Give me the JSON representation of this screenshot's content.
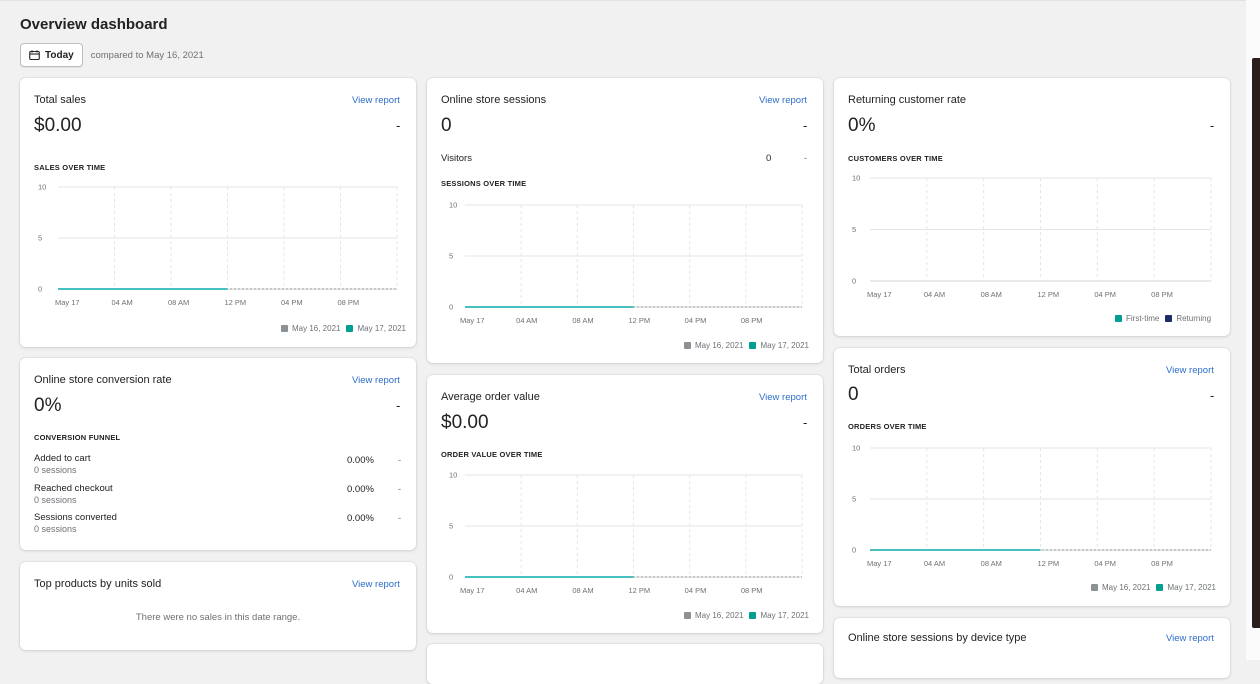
{
  "page": {
    "title": "Overview dashboard",
    "date_button": "Today",
    "compared_to": "compared to May 16, 2021"
  },
  "colors": {
    "accent_teal": "#47c1bf",
    "teal_swatch": "#009e93",
    "gray_swatch": "#8c9196",
    "navy_swatch": "#1f2a6b",
    "link": "#2c6ecb"
  },
  "x_labels": [
    "May 17",
    "04 AM",
    "08 AM",
    "12 PM",
    "04 PM",
    "08 PM"
  ],
  "cards": {
    "total_sales": {
      "title": "Total sales",
      "view": "View report",
      "value": "$0.00",
      "trend": "-",
      "section": "SALES OVER TIME",
      "legend": [
        "May 16, 2021",
        "May 17, 2021"
      ]
    },
    "sessions": {
      "title": "Online store sessions",
      "view": "View report",
      "value": "0",
      "trend": "-",
      "visitors_label": "Visitors",
      "visitors_value": "0",
      "visitors_trend": "-",
      "section": "SESSIONS OVER TIME",
      "legend": [
        "May 16, 2021",
        "May 17, 2021"
      ]
    },
    "returning": {
      "title": "Returning customer rate",
      "value": "0%",
      "trend": "-",
      "section": "CUSTOMERS OVER TIME",
      "legend": [
        "First-time",
        "Returning"
      ]
    },
    "conversion": {
      "title": "Online store conversion rate",
      "view": "View report",
      "value": "0%",
      "trend": "-",
      "section": "CONVERSION FUNNEL",
      "rows": [
        {
          "label": "Added to cart",
          "sub": "0 sessions",
          "value": "0.00%",
          "trend": "-"
        },
        {
          "label": "Reached checkout",
          "sub": "0 sessions",
          "value": "0.00%",
          "trend": "-"
        },
        {
          "label": "Sessions converted",
          "sub": "0 sessions",
          "value": "0.00%",
          "trend": "-"
        }
      ]
    },
    "aov": {
      "title": "Average order value",
      "view": "View report",
      "value": "$0.00",
      "trend": "-",
      "section": "ORDER VALUE OVER TIME",
      "legend": [
        "May 16, 2021",
        "May 17, 2021"
      ]
    },
    "orders": {
      "title": "Total orders",
      "view": "View report",
      "value": "0",
      "trend": "-",
      "section": "ORDERS OVER TIME",
      "legend": [
        "May 16, 2021",
        "May 17, 2021"
      ]
    },
    "top_products": {
      "title": "Top products by units sold",
      "view": "View report",
      "empty": "There were no sales in this date range."
    },
    "device": {
      "title": "Online store sessions by device type",
      "view": "View report"
    }
  },
  "chart_data": [
    {
      "type": "line",
      "title": "SALES OVER TIME",
      "categories": [
        "May 17",
        "04 AM",
        "08 AM",
        "12 PM",
        "04 PM",
        "08 PM"
      ],
      "ylim": [
        0,
        10
      ],
      "yticks": [
        0,
        5,
        10
      ],
      "grid": true,
      "legend": "bottom-right",
      "series": [
        {
          "name": "May 16, 2021",
          "values": [
            0,
            0,
            0,
            0,
            0,
            0
          ],
          "style": "dashed"
        },
        {
          "name": "May 17, 2021",
          "values": [
            0,
            0,
            0,
            0
          ],
          "style": "solid"
        }
      ]
    },
    {
      "type": "line",
      "title": "SESSIONS OVER TIME",
      "categories": [
        "May 17",
        "04 AM",
        "08 AM",
        "12 PM",
        "04 PM",
        "08 PM"
      ],
      "ylim": [
        0,
        10
      ],
      "yticks": [
        0,
        5,
        10
      ],
      "grid": true,
      "legend": "bottom-right",
      "series": [
        {
          "name": "May 16, 2021",
          "values": [
            0,
            0,
            0,
            0,
            0,
            0
          ],
          "style": "dashed"
        },
        {
          "name": "May 17, 2021",
          "values": [
            0,
            0,
            0,
            0
          ],
          "style": "solid"
        }
      ]
    },
    {
      "type": "line",
      "title": "CUSTOMERS OVER TIME",
      "categories": [
        "May 17",
        "04 AM",
        "08 AM",
        "12 PM",
        "04 PM",
        "08 PM"
      ],
      "ylim": [
        0,
        10
      ],
      "yticks": [
        0,
        5,
        10
      ],
      "grid": true,
      "legend": "bottom-right",
      "series": [
        {
          "name": "First-time",
          "values": []
        },
        {
          "name": "Returning",
          "values": []
        }
      ]
    },
    {
      "type": "line",
      "title": "ORDER VALUE OVER TIME",
      "categories": [
        "May 17",
        "04 AM",
        "08 AM",
        "12 PM",
        "04 PM",
        "08 PM"
      ],
      "ylim": [
        0,
        10
      ],
      "yticks": [
        0,
        5,
        10
      ],
      "grid": true,
      "legend": "bottom-right",
      "series": [
        {
          "name": "May 16, 2021",
          "values": [
            0,
            0,
            0,
            0,
            0,
            0
          ],
          "style": "dashed"
        },
        {
          "name": "May 17, 2021",
          "values": [
            0,
            0,
            0,
            0
          ],
          "style": "solid"
        }
      ]
    },
    {
      "type": "line",
      "title": "ORDERS OVER TIME",
      "categories": [
        "May 17",
        "04 AM",
        "08 AM",
        "12 PM",
        "04 PM",
        "08 PM"
      ],
      "ylim": [
        0,
        10
      ],
      "yticks": [
        0,
        5,
        10
      ],
      "grid": true,
      "legend": "bottom-right",
      "series": [
        {
          "name": "May 16, 2021",
          "values": [
            0,
            0,
            0,
            0,
            0,
            0
          ],
          "style": "dashed"
        },
        {
          "name": "May 17, 2021",
          "values": [
            0,
            0,
            0,
            0
          ],
          "style": "solid"
        }
      ]
    }
  ]
}
